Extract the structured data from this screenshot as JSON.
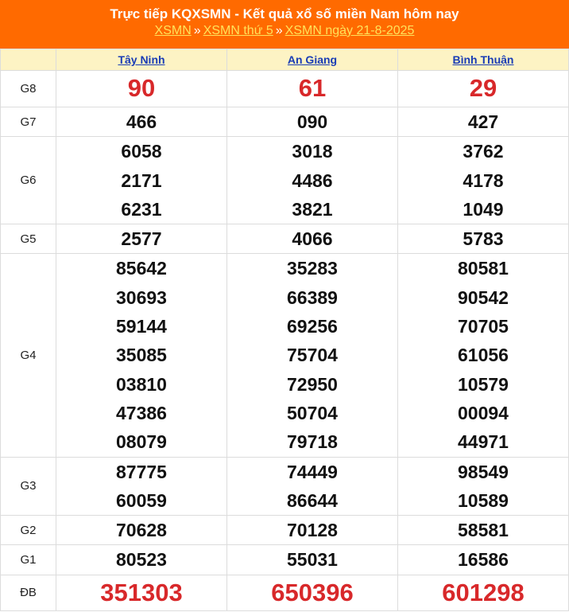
{
  "header": {
    "title": "Trực tiếp KQXSMN - Kết quả xổ số miền Nam hôm nay",
    "crumbs": [
      "XSMN",
      "XSMN thứ 5",
      "XSMN ngày 21-8-2025"
    ],
    "separator": "»"
  },
  "provinces": [
    "Tây Ninh",
    "An Giang",
    "Bình Thuận"
  ],
  "prizes": [
    {
      "label": "G8",
      "values": [
        [
          "90"
        ],
        [
          "61"
        ],
        [
          "29"
        ]
      ]
    },
    {
      "label": "G7",
      "values": [
        [
          "466"
        ],
        [
          "090"
        ],
        [
          "427"
        ]
      ]
    },
    {
      "label": "G6",
      "values": [
        [
          "6058",
          "2171",
          "6231"
        ],
        [
          "3018",
          "4486",
          "3821"
        ],
        [
          "3762",
          "4178",
          "1049"
        ]
      ]
    },
    {
      "label": "G5",
      "values": [
        [
          "2577"
        ],
        [
          "4066"
        ],
        [
          "5783"
        ]
      ]
    },
    {
      "label": "G4",
      "values": [
        [
          "85642",
          "30693",
          "59144",
          "35085",
          "03810",
          "47386",
          "08079"
        ],
        [
          "35283",
          "66389",
          "69256",
          "75704",
          "72950",
          "50704",
          "79718"
        ],
        [
          "80581",
          "90542",
          "70705",
          "61056",
          "10579",
          "00094",
          "44971"
        ]
      ]
    },
    {
      "label": "G3",
      "values": [
        [
          "87775",
          "60059"
        ],
        [
          "74449",
          "86644"
        ],
        [
          "98549",
          "10589"
        ]
      ]
    },
    {
      "label": "G2",
      "values": [
        [
          "70628"
        ],
        [
          "70128"
        ],
        [
          "58581"
        ]
      ]
    },
    {
      "label": "G1",
      "values": [
        [
          "80523"
        ],
        [
          "55031"
        ],
        [
          "16586"
        ]
      ]
    },
    {
      "label": "ĐB",
      "values": [
        [
          "351303"
        ],
        [
          "650396"
        ],
        [
          "601298"
        ]
      ]
    }
  ],
  "colors": {
    "header_bg": "#ff6a00",
    "highlight": "#d8282a",
    "link": "#1a3db5"
  }
}
